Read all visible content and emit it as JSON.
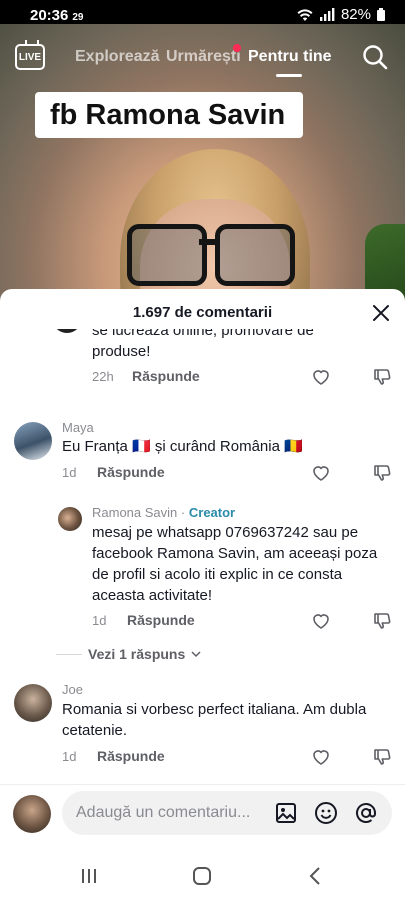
{
  "status_bar": {
    "time": "20:36",
    "network": "29",
    "battery": "82%"
  },
  "top_nav": {
    "live_label": "LIVE",
    "tabs": [
      "Explorează",
      "Urmărești",
      "Pentru tine"
    ],
    "active_tab": "Pentru tine"
  },
  "video": {
    "overlay_text": "fb Ramona Savin"
  },
  "comments_sheet": {
    "count_label": "1.697 de comentarii",
    "comments": [
      {
        "username": "",
        "text": "se lucreaza online, promovare de produse!",
        "age": "22h",
        "reply_label": "Răspunde"
      },
      {
        "username": "Maya",
        "text": "Eu Franța 🇫🇷 și curând România 🇷🇴",
        "age": "1d",
        "reply_label": "Răspunde"
      },
      {
        "username": "Ramona Savin",
        "creator_tag": "Creator",
        "separator": "·",
        "text": "mesaj pe whatsapp 0769637242 sau pe facebook Ramona Savin, am aceeași poza de profil si acolo iti explic in ce consta aceasta activitate!",
        "age": "1d",
        "reply_label": "Răspunde"
      },
      {
        "username": "Joe",
        "text": "Romania si vorbesc perfect italiana. Am dubla cetatenie.",
        "age": "1d",
        "reply_label": "Răspunde"
      }
    ],
    "view_replies_label": "Vezi 1 răspuns",
    "composer": {
      "placeholder": "Adaugă un comentariu..."
    }
  },
  "icons": {
    "close": "close-icon",
    "like": "heart-outline-icon",
    "dislike": "thumbs-down-icon",
    "image": "image-icon",
    "emoji": "emoji-icon",
    "mention": "at-sign-icon",
    "search": "search-icon",
    "recent_apps": "recent-apps-icon",
    "home": "home-icon",
    "back": "back-icon"
  },
  "colors": {
    "accent": "#fe2c55",
    "creator": "#2b8bab",
    "text": "#161823",
    "muted": "#8a8b91"
  }
}
